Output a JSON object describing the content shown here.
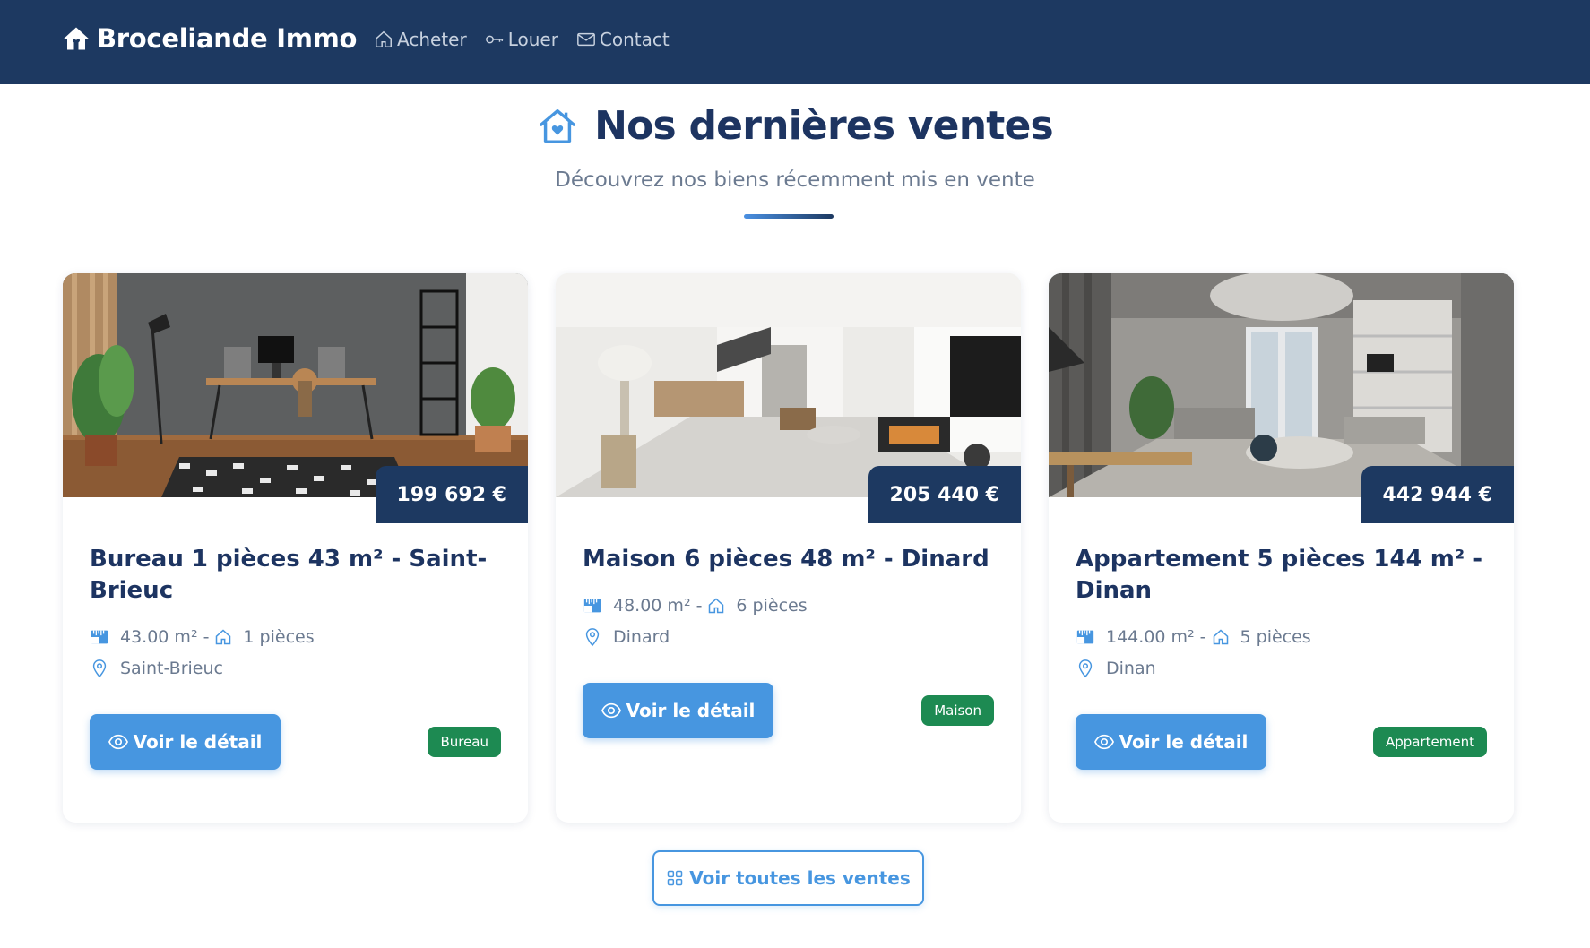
{
  "navbar": {
    "brand": "Broceliande Immo",
    "links": [
      {
        "label": "Acheter",
        "icon": "house-icon"
      },
      {
        "label": "Louer",
        "icon": "key-icon"
      },
      {
        "label": "Contact",
        "icon": "envelope-icon"
      }
    ]
  },
  "hero": {
    "title": "Nos dernières ventes",
    "subtitle": "Découvrez nos biens récemment mis en vente"
  },
  "cards": [
    {
      "price": "199 692 €",
      "title": "Bureau 1 pièces 43 m² - Saint-Brieuc",
      "surface": "43.00 m²",
      "rooms": "1 pièces",
      "city": "Saint-Brieuc",
      "button": "Voir le détail",
      "type": "Bureau"
    },
    {
      "price": "205 440 €",
      "title": "Maison 6 pièces 48 m² - Dinard",
      "surface": "48.00 m²",
      "rooms": "6 pièces",
      "city": "Dinard",
      "button": "Voir le détail",
      "type": "Maison"
    },
    {
      "price": "442 944 €",
      "title": "Appartement 5 pièces 144 m² - Dinan",
      "surface": "144.00 m²",
      "rooms": "5 pièces",
      "city": "Dinan",
      "button": "Voir le détail",
      "type": "Appartement"
    }
  ],
  "all_sales_button": "Voir toutes les ventes",
  "colors": {
    "navbar": "#1d3961",
    "primary": "#4796e0",
    "title": "#1d3461",
    "badge_green": "#1d8a52"
  }
}
